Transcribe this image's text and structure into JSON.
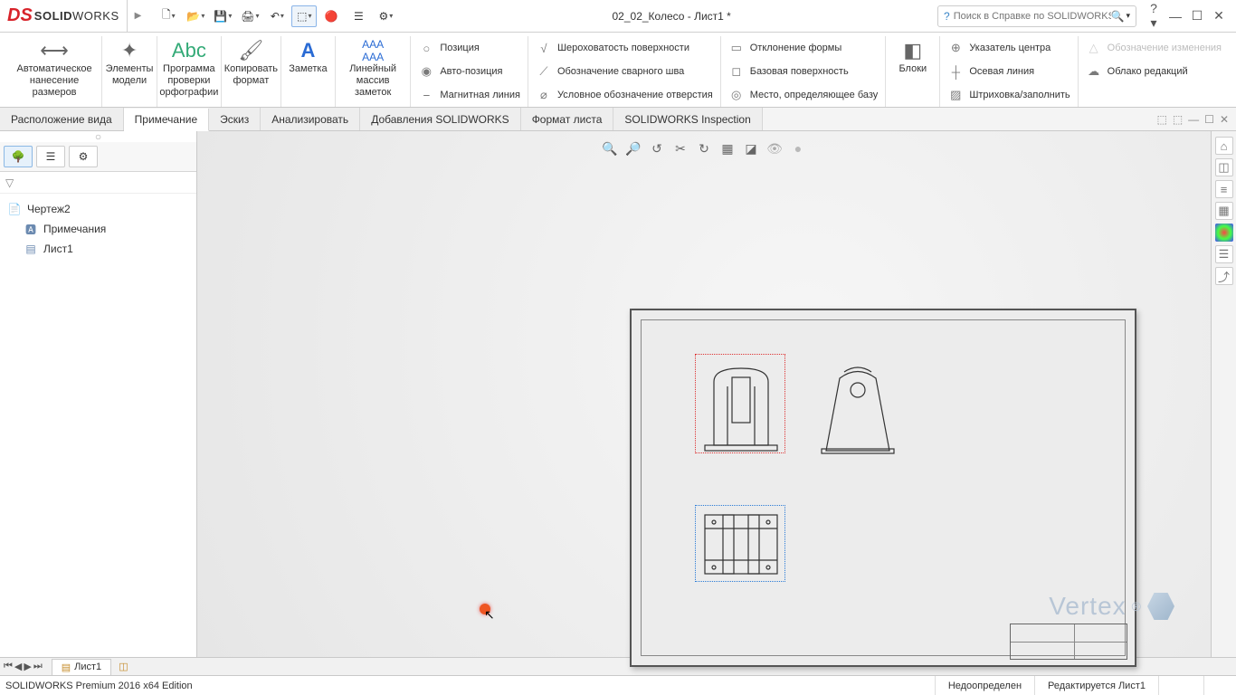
{
  "app": {
    "name_prefix": "SOLID",
    "name_suffix": "WORKS"
  },
  "document_title": "02_02_Колесо - Лист1 *",
  "search": {
    "placeholder": "Поиск в Справке по SOLIDWORKS"
  },
  "ribbon": {
    "big": [
      {
        "label": "Автоматическое\nнанесение размеров"
      },
      {
        "label": "Элементы\nмодели"
      },
      {
        "label": "Программа\nпроверки\nорфографии"
      },
      {
        "label": "Копировать\nформат"
      },
      {
        "label": "Заметка"
      },
      {
        "label": "Линейный\nмассив заметок"
      }
    ],
    "col1": [
      {
        "label": "Позиция"
      },
      {
        "label": "Авто-позиция"
      },
      {
        "label": "Магнитная линия"
      }
    ],
    "col2": [
      {
        "label": "Шероховатость поверхности"
      },
      {
        "label": "Обозначение сварного шва"
      },
      {
        "label": "Условное обозначение отверстия"
      }
    ],
    "col3": [
      {
        "label": "Отклонение формы"
      },
      {
        "label": "Базовая поверхность"
      },
      {
        "label": "Место, определяющее базу"
      }
    ],
    "col4_big": {
      "label": "Блоки"
    },
    "col5": [
      {
        "label": "Указатель центра"
      },
      {
        "label": "Осевая линия"
      },
      {
        "label": "Штриховка/заполнить"
      }
    ],
    "col6": [
      {
        "label": "Обозначение изменения",
        "disabled": true
      },
      {
        "label": "Облако редакций",
        "disabled": false
      }
    ]
  },
  "tabs": [
    "Расположение вида",
    "Примечание",
    "Эскиз",
    "Анализировать",
    "Добавления SOLIDWORKS",
    "Формат листа",
    "SOLIDWORKS Inspection"
  ],
  "active_tab_index": 1,
  "tree": {
    "root": "Чертеж2",
    "children": [
      "Примечания",
      "Лист1"
    ]
  },
  "sheet_tab": "Лист1",
  "status": {
    "edition": "SOLIDWORKS Premium 2016 x64 Edition",
    "cell1": "Недоопределен",
    "cell2": "Редактируется Лист1"
  },
  "watermark": "Vertex"
}
